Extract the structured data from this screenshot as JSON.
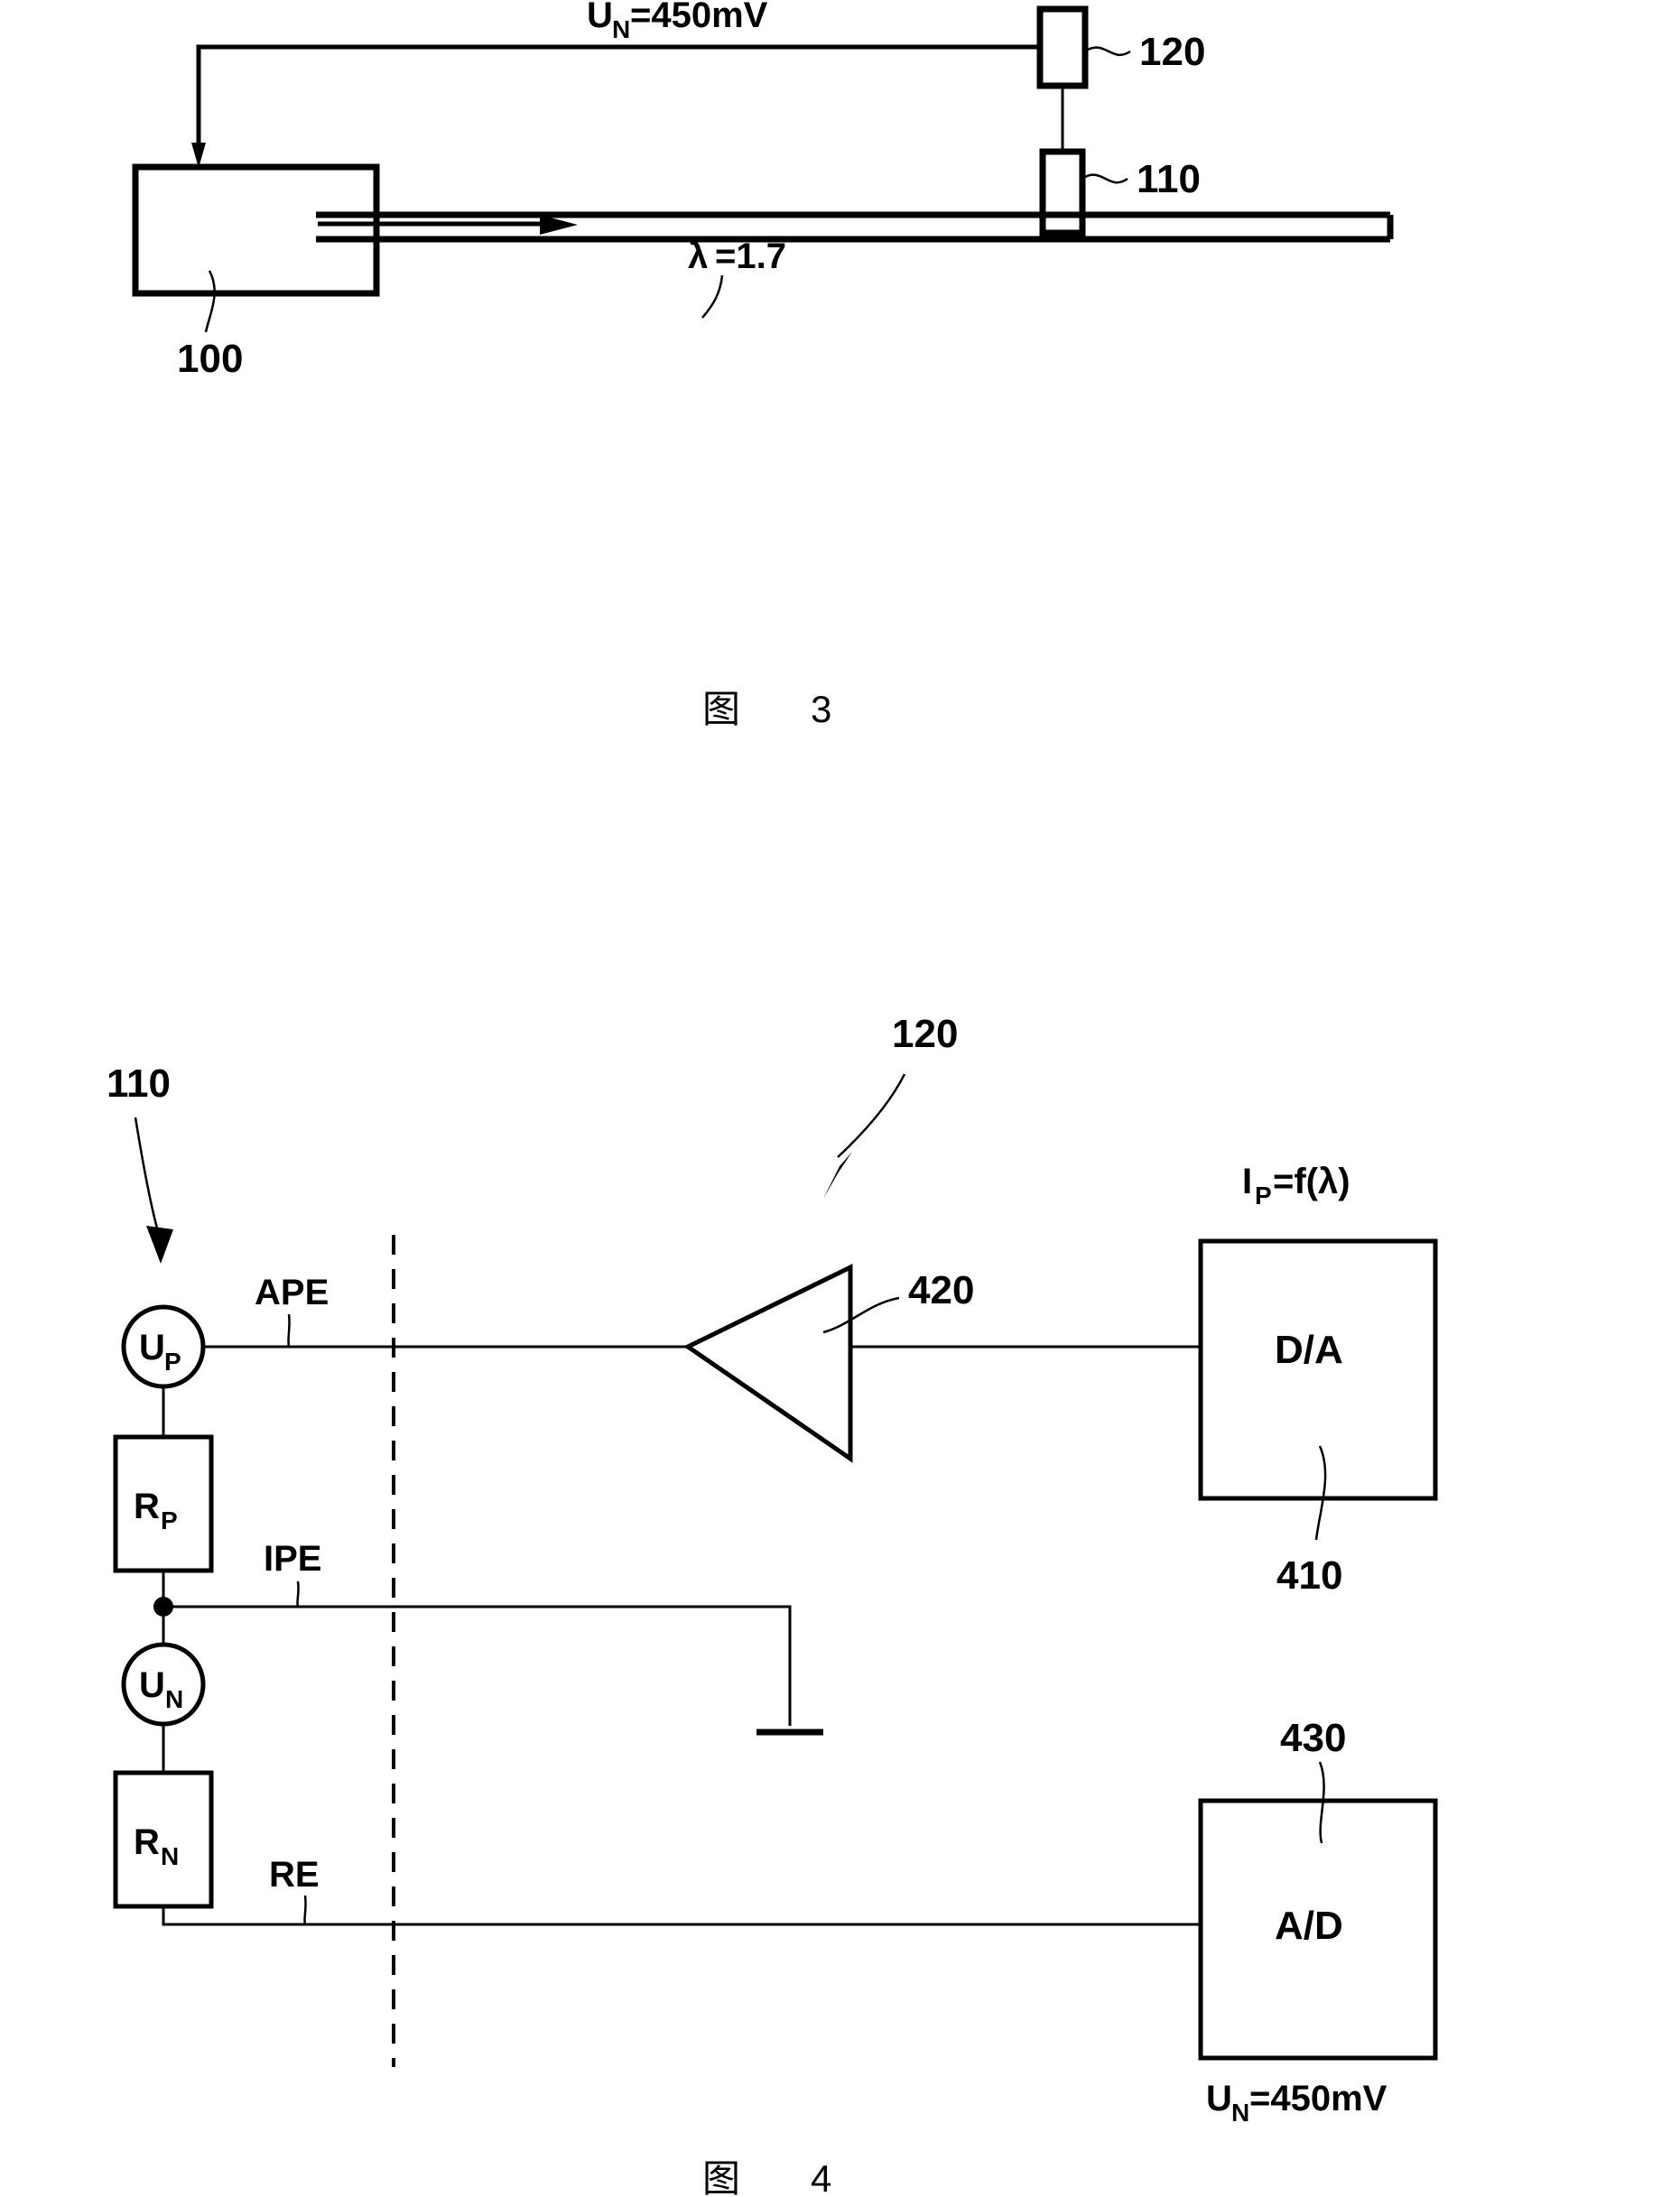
{
  "page": {
    "background": "#ffffff",
    "ink": "#000000"
  },
  "figure3": {
    "caption_cn": "图",
    "caption_num": "3",
    "labels": {
      "nernst_voltage": "U",
      "nernst_voltage_sub": "N",
      "nernst_voltage_value": "=450mV",
      "lambda": "λ",
      "lambda_value": "=1.7"
    },
    "references": {
      "control_unit": "100",
      "sensor_element": "110",
      "evaluation_unit": "120"
    }
  },
  "figure4": {
    "caption_cn": "图",
    "caption_num": "4",
    "references": {
      "sensor_element": "110",
      "evaluation_circuit": "120",
      "da_converter": "410",
      "amplifier": "420",
      "ad_converter": "430"
    },
    "sources": [
      {
        "symbol": "U",
        "subscript": "P",
        "name": "pump-voltage-source"
      },
      {
        "symbol": "U",
        "subscript": "N",
        "name": "nernst-voltage-source"
      }
    ],
    "resistors": [
      {
        "symbol": "R",
        "subscript": "P",
        "name": "pump-resistor"
      },
      {
        "symbol": "R",
        "subscript": "N",
        "name": "nernst-resistor"
      }
    ],
    "terminals": {
      "ape": "APE",
      "ipe": "IPE",
      "re": "RE"
    },
    "blocks": {
      "da": "D/A",
      "ad": "A/D"
    },
    "annotations": {
      "pump_current": "I",
      "pump_current_sub": "P",
      "pump_current_expr": "=f(λ)",
      "nernst_voltage": "U",
      "nernst_voltage_sub": "N",
      "nernst_voltage_value": "=450mV"
    }
  }
}
